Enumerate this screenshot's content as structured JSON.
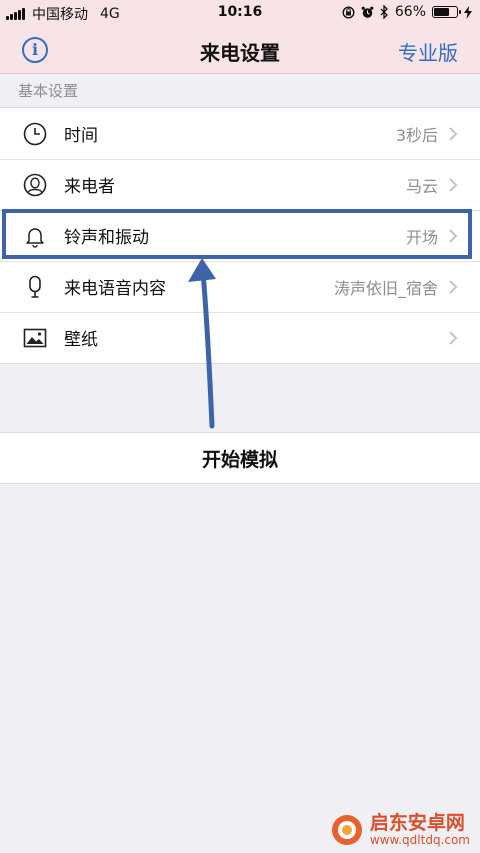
{
  "status_bar": {
    "carrier": "中国移动",
    "network": "4G",
    "time": "10:16",
    "battery": "66%",
    "battery_level": 0.66
  },
  "nav": {
    "title": "来电设置",
    "right_link": "专业版"
  },
  "section": {
    "header": "基本设置"
  },
  "rows": [
    {
      "label": "时间",
      "value": "3秒后",
      "icon": "clock-icon"
    },
    {
      "label": "来电者",
      "value": "马云",
      "icon": "person-icon"
    },
    {
      "label": "铃声和振动",
      "value": "开场",
      "icon": "bell-icon"
    },
    {
      "label": "来电语音内容",
      "value": "涛声依旧_宿舍",
      "icon": "microphone-icon"
    },
    {
      "label": "壁纸",
      "value": "",
      "icon": "image-icon"
    }
  ],
  "simulate": {
    "label": "开始模拟"
  },
  "watermark": {
    "title": "启东安卓网",
    "url": "www.qdltdq.com"
  },
  "colors": {
    "accent": "#2f6fc6",
    "nav_bg": "#f8e3e6",
    "annotation": "#3d64a8",
    "page_bg": "#efeff4"
  }
}
